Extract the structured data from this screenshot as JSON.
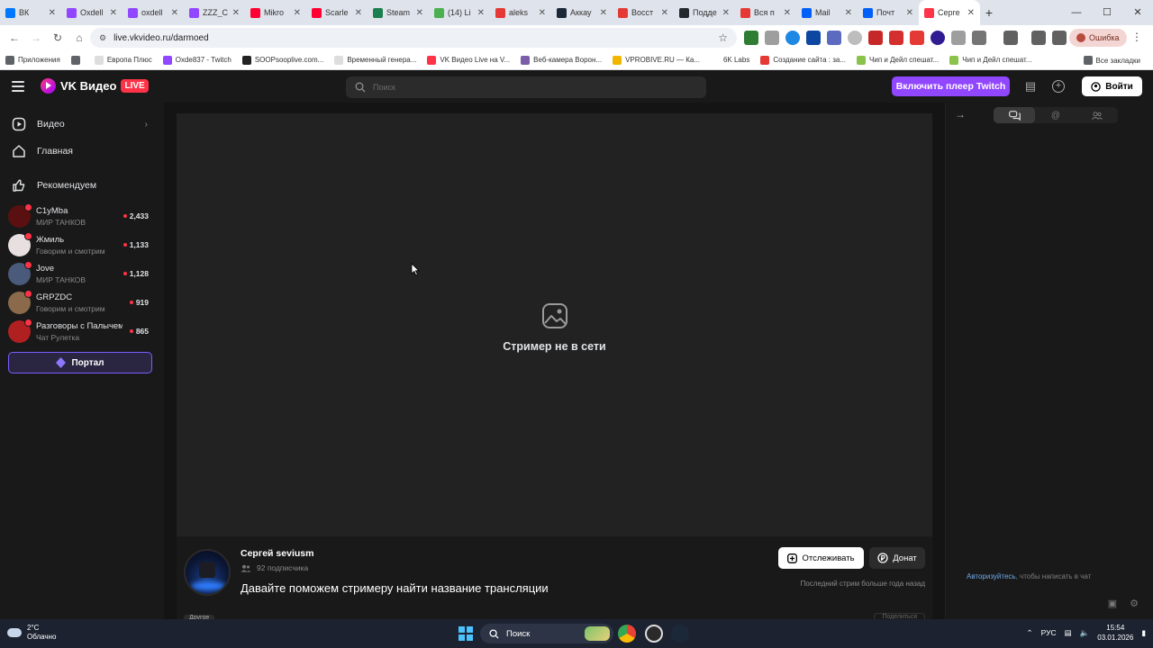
{
  "browser": {
    "tabs": [
      {
        "label": "ВК",
        "color": "#0077ff"
      },
      {
        "label": "Oxdell",
        "color": "#9146ff"
      },
      {
        "label": "oxdell",
        "color": "#9146ff"
      },
      {
        "label": "ZZZ_C",
        "color": "#9146ff"
      },
      {
        "label": "Mikro",
        "color": "#ff0033"
      },
      {
        "label": "Scarle",
        "color": "#ff0033"
      },
      {
        "label": "Steam",
        "color": "#1b7f4f"
      },
      {
        "label": "(14) Li",
        "color": "#4caf50"
      },
      {
        "label": "aleks",
        "color": "#e53935"
      },
      {
        "label": "Аккау",
        "color": "#1b2838"
      },
      {
        "label": "Восст",
        "color": "#e53935"
      },
      {
        "label": "Подде",
        "color": "#24292f"
      },
      {
        "label": "Вся п",
        "color": "#e53935"
      },
      {
        "label": "Mail",
        "color": "#005ff9"
      },
      {
        "label": "Почт",
        "color": "#005ff9"
      },
      {
        "label": "Серге",
        "color": "#ff3347"
      }
    ],
    "active_tab": 15,
    "new_tab": "+",
    "url": "live.vkvideo.ru/darmoed",
    "error_chip": "Ошибка",
    "bookmarks": [
      {
        "label": "Приложения",
        "color": "#5f6368"
      },
      {
        "label": "",
        "color": "#5f6368"
      },
      {
        "label": "Европа Плюс",
        "color": "#dddddd"
      },
      {
        "label": "Oxde837 - Twitch",
        "color": "#9146ff"
      },
      {
        "label": "SOOPsooplive.com...",
        "color": "#222222"
      },
      {
        "label": "Временный генера...",
        "color": "#dddddd"
      },
      {
        "label": "VK Видео Live на V...",
        "color": "#ff3347"
      },
      {
        "label": "Веб-камера Ворон...",
        "color": "#7b5ea7"
      },
      {
        "label": "VPROBIVE.RU — Ка...",
        "color": "#f2b600"
      },
      {
        "label": "6K Labs",
        "color": "#ffffff"
      },
      {
        "label": "Создание сайта : за...",
        "color": "#e53935"
      },
      {
        "label": "Чип и Дейл спешат...",
        "color": "#8bc34a"
      },
      {
        "label": "Чип и Дейл спешат...",
        "color": "#8bc34a"
      }
    ],
    "bookmarks_right": "Все закладки"
  },
  "header": {
    "logo_text": "VK Видео",
    "live_badge": "LIVE",
    "search_placeholder": "Поиск",
    "twitch_button": "Включить плеер Twitch",
    "login_button": "Войти"
  },
  "sidebar": {
    "nav": [
      {
        "label": "Видео",
        "icon": "play-square-icon",
        "chevron": "›"
      },
      {
        "label": "Главная",
        "icon": "home-icon"
      },
      {
        "label": "Рекомендуем",
        "icon": "thumbs-up-icon"
      }
    ],
    "channels": [
      {
        "name": "C1yMba",
        "category": "МИР ТАНКОВ",
        "viewers": "2,433",
        "color": "#5a1010"
      },
      {
        "name": "Жмиль",
        "category": "Говорим и смотрим",
        "viewers": "1,133",
        "color": "#e8e0e0"
      },
      {
        "name": "Jove",
        "category": "МИР ТАНКОВ",
        "viewers": "1,128",
        "color": "#4a5a7a"
      },
      {
        "name": "GRPZDC",
        "category": "Говорим и смотрим",
        "viewers": "919",
        "color": "#8a6a4a"
      },
      {
        "name": "Разговоры с Палычем",
        "category": "Чат Рулетка",
        "viewers": "865",
        "color": "#b02020"
      }
    ],
    "portal_button": "Портал"
  },
  "player": {
    "offline_text": "Стример не в сети"
  },
  "stream_info": {
    "streamer_name": "Сергей seviusm",
    "subscribers": "92 подписчика",
    "title": "Давайте поможем стримеру найти название трансляции",
    "follow_button": "Отслеживать",
    "donate_button": "Донат",
    "last_stream": "Последний стрим больше года назад",
    "tag": "Другое",
    "ghost_button": "Поделиться"
  },
  "chat": {
    "auth_link": "Авторизуйтесь",
    "auth_text": ", чтобы написать в чат"
  },
  "taskbar": {
    "weather_temp": "2°C",
    "weather_desc": "Облачно",
    "search_label": "Поиск",
    "language": "РУС",
    "time": "15:54",
    "date": "03.01.2026"
  }
}
